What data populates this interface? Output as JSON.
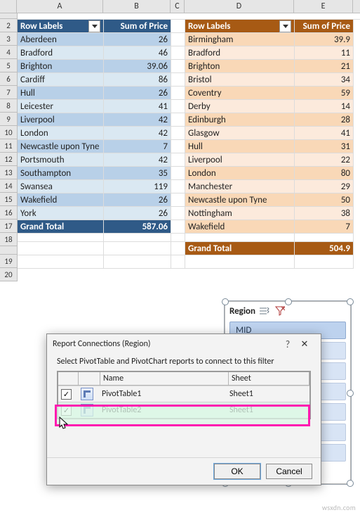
{
  "columns": [
    "A",
    "B",
    "C",
    "D",
    "E"
  ],
  "row_numbers": [
    2,
    3,
    4,
    5,
    6,
    7,
    8,
    9,
    10,
    11,
    12,
    13,
    14,
    15,
    16,
    17,
    18,
    19,
    20
  ],
  "blank_top_row_height": 8,
  "pivot1": {
    "header_labels": [
      "Row Labels",
      "Sum of Price"
    ],
    "rows": [
      {
        "label": "Aberdeen",
        "value": "26"
      },
      {
        "label": "Bradford",
        "value": "46"
      },
      {
        "label": "Brighton",
        "value": "39.06"
      },
      {
        "label": "Cardiff",
        "value": "86"
      },
      {
        "label": "Hull",
        "value": "26"
      },
      {
        "label": "Leicester",
        "value": "41"
      },
      {
        "label": "Liverpool",
        "value": "42"
      },
      {
        "label": "London",
        "value": "42"
      },
      {
        "label": "Newcastle upon Tyne",
        "value": "7"
      },
      {
        "label": "Portsmouth",
        "value": "42"
      },
      {
        "label": "Southampton",
        "value": "35"
      },
      {
        "label": "Swansea",
        "value": "119"
      },
      {
        "label": "Wakefield",
        "value": "26"
      },
      {
        "label": "York",
        "value": "26"
      }
    ],
    "total_label": "Grand Total",
    "total_value": "587.06"
  },
  "pivot2": {
    "header_labels": [
      "Row Labels",
      "Sum of Price"
    ],
    "rows": [
      {
        "label": "Birmingham",
        "value": "39.9"
      },
      {
        "label": "Bradford",
        "value": "11"
      },
      {
        "label": "Brighton",
        "value": "21"
      },
      {
        "label": "Bristol",
        "value": "34"
      },
      {
        "label": "Coventry",
        "value": "59"
      },
      {
        "label": "Derby",
        "value": "14"
      },
      {
        "label": "Edinburgh",
        "value": "28"
      },
      {
        "label": "Glasgow",
        "value": "41"
      },
      {
        "label": "Hull",
        "value": "31"
      },
      {
        "label": "Liverpool",
        "value": "22"
      },
      {
        "label": "London",
        "value": "80"
      },
      {
        "label": "Manchester",
        "value": "29"
      },
      {
        "label": "Newcastle upon Tyne",
        "value": "50"
      },
      {
        "label": "Nottingham",
        "value": "38"
      },
      {
        "label": "Wakefield",
        "value": "7"
      }
    ],
    "total_label": "Grand Total",
    "total_value": "504.9"
  },
  "slicer": {
    "title": "Region",
    "items": [
      "MID"
    ]
  },
  "dialog": {
    "title": "Report Connections (Region)",
    "instruction": "Select PivotTable and PivotChart reports to connect to this filter",
    "columns": [
      "Name",
      "Sheet"
    ],
    "rows": [
      {
        "checked": true,
        "name": "PivotTable1",
        "sheet": "Sheet1"
      },
      {
        "checked": true,
        "name": "PivotTable2",
        "sheet": "Sheet1"
      }
    ],
    "buttons": {
      "ok": "OK",
      "cancel": "Cancel"
    },
    "help_char": "?",
    "close_char": "✕"
  },
  "watermark": "wsxdn.com"
}
